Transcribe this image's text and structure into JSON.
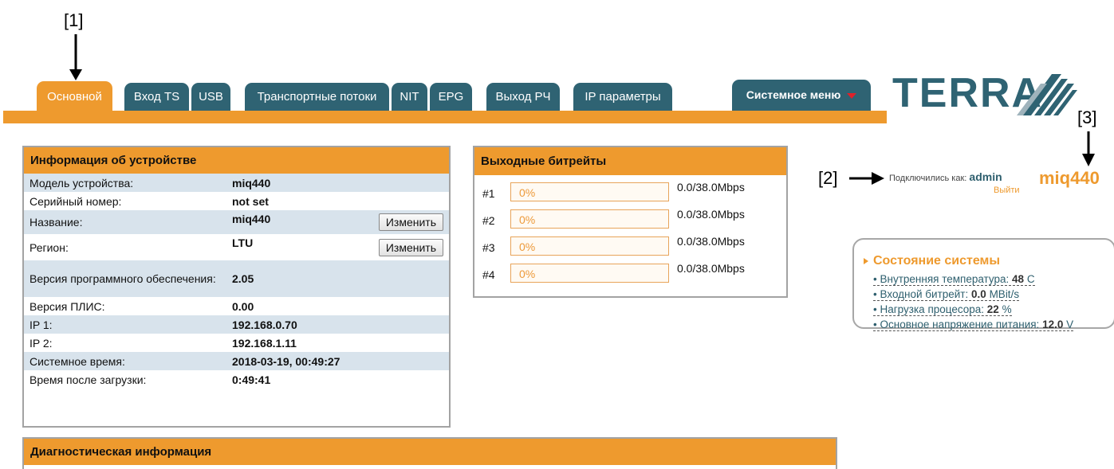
{
  "callouts": {
    "c1": "[1]",
    "c2": "[2]",
    "c3": "[3]"
  },
  "tabs": {
    "main": "Основной",
    "input_ts": "Вход TS",
    "usb": "USB",
    "transport_streams": "Транспортные потоки",
    "nit": "NIT",
    "epg": "EPG",
    "output_rf": "Выход РЧ",
    "ip_params": "IP параметры",
    "system_menu": "Системное меню"
  },
  "brand": {
    "logo_text": "TERRA"
  },
  "user": {
    "connected_label": "Подключились как:",
    "username": "admin",
    "logout": "Выйти",
    "device_name": "miq440"
  },
  "device_info": {
    "title": "Информация об устройстве",
    "change_label": "Изменить",
    "rows": [
      {
        "key": "Модель устройства:",
        "value": "miq440"
      },
      {
        "key": "Серийный номер:",
        "value": "not set"
      },
      {
        "key": "Название:",
        "value": "miq440"
      },
      {
        "key": "Регион:",
        "value": "LTU"
      },
      {
        "key": "Версия программного обеспечения:",
        "value": "2.05"
      },
      {
        "key": "Версия ПЛИС:",
        "value": "0.00"
      },
      {
        "key": "IP 1:",
        "value": "192.168.0.70"
      },
      {
        "key": "IP 2:",
        "value": "192.168.1.11"
      },
      {
        "key": "Системное время:",
        "value": "2018-03-19, 00:49:27"
      },
      {
        "key": "Время после загрузки:",
        "value": "0:49:41"
      }
    ]
  },
  "bitrates": {
    "title": "Выходные битрейты",
    "rows": [
      {
        "num": "#1",
        "percent": "0%",
        "value": "0.0/38.0Mbps"
      },
      {
        "num": "#2",
        "percent": "0%",
        "value": "0.0/38.0Mbps"
      },
      {
        "num": "#3",
        "percent": "0%",
        "value": "0.0/38.0Mbps"
      },
      {
        "num": "#4",
        "percent": "0%",
        "value": "0.0/38.0Mbps"
      }
    ]
  },
  "system_status": {
    "title": "Состояние системы",
    "temp_label": "Внутренняя температура:",
    "temp_value": "48",
    "temp_unit": "C",
    "bitrate_label": "Входной битрейт:",
    "bitrate_value": "0.0",
    "bitrate_unit": "MBit/s",
    "cpu_label": "Нагрузка процесора:",
    "cpu_value": "22",
    "cpu_unit": "%",
    "voltage_label": "Основное напряжение питания:",
    "voltage_value": "12.0",
    "voltage_unit": "V"
  },
  "diagnostics": {
    "title": "Диагностическая информация"
  },
  "colors": {
    "accent": "#ee9a2e",
    "tab": "#2f6373",
    "row_alt": "#d8e3ec"
  }
}
